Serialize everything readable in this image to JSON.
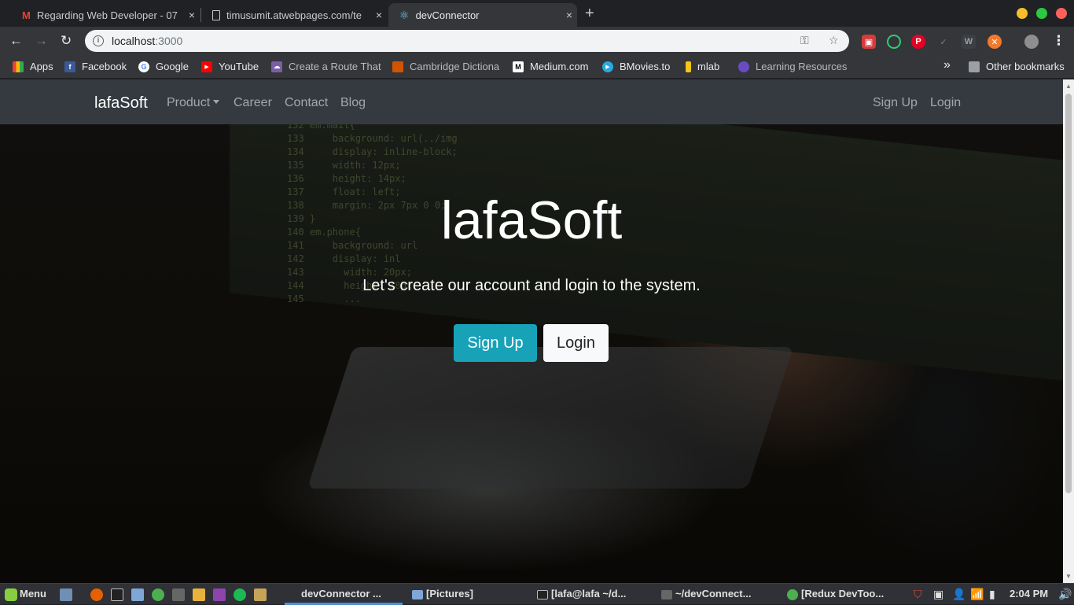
{
  "browser": {
    "tabs": [
      {
        "title": "Regarding Web Developer - 07",
        "icon": "gmail-icon"
      },
      {
        "title": "timusumit.atwebpages.com/te",
        "icon": "page-icon"
      },
      {
        "title": "devConnector",
        "icon": "react-icon"
      }
    ],
    "new_tab": "+",
    "close": "×",
    "url_host": "localhost",
    "url_port": ":3000",
    "bookmarks": [
      {
        "label": "Apps",
        "color": "#4285f4"
      },
      {
        "label": "Facebook",
        "color": "#3b5998"
      },
      {
        "label": "Google",
        "color": "#ea4335"
      },
      {
        "label": "YouTube",
        "color": "#ff0000"
      },
      {
        "label": "Create a Route That",
        "color": "#7b5ea7"
      },
      {
        "label": "Cambridge Dictiona",
        "color": "#d35400"
      },
      {
        "label": "Medium.com",
        "color": "#000000"
      },
      {
        "label": "BMovies.to",
        "color": "#2aa8e0"
      },
      {
        "label": "mlab",
        "color": "#f5c518"
      },
      {
        "label": "Learning Resources",
        "color": "#6a4cc2"
      }
    ],
    "more": "»",
    "other_bookmarks": "Other bookmarks"
  },
  "site": {
    "brand": "lafaSoft",
    "nav": {
      "product": "Product",
      "career": "Career",
      "contact": "Contact",
      "blog": "Blog"
    },
    "auth": {
      "signup": "Sign Up",
      "login": "Login"
    },
    "hero": {
      "title": "lafaSoft",
      "lead": "Let's create our account and login to the system.",
      "signup": "Sign Up",
      "login": "Login"
    }
  },
  "code_lines": "132 em.mail{\n133     background: url(../img\n134     display: inline-block;\n135     width: 12px;\n136     height: 14px;\n137     float: left;\n138     margin: 2px 7px 0 0;\n139 }\n140 em.phone{\n141     background: url\n142     display: inl\n143       width: 20px;\n144       height: 18px;\n145       ...",
  "taskbar": {
    "menu": "Menu",
    "windows": [
      {
        "label": "devConnector ..."
      },
      {
        "label": "[Pictures]"
      },
      {
        "label": "[lafa@lafa ~/d..."
      },
      {
        "label": "~/devConnect..."
      },
      {
        "label": "[Redux DevToo..."
      }
    ],
    "clock": "2:04 PM"
  },
  "colors": {
    "accent": "#17a2b8",
    "navbar": "#343a40",
    "light_btn": "#f8f9fa"
  }
}
